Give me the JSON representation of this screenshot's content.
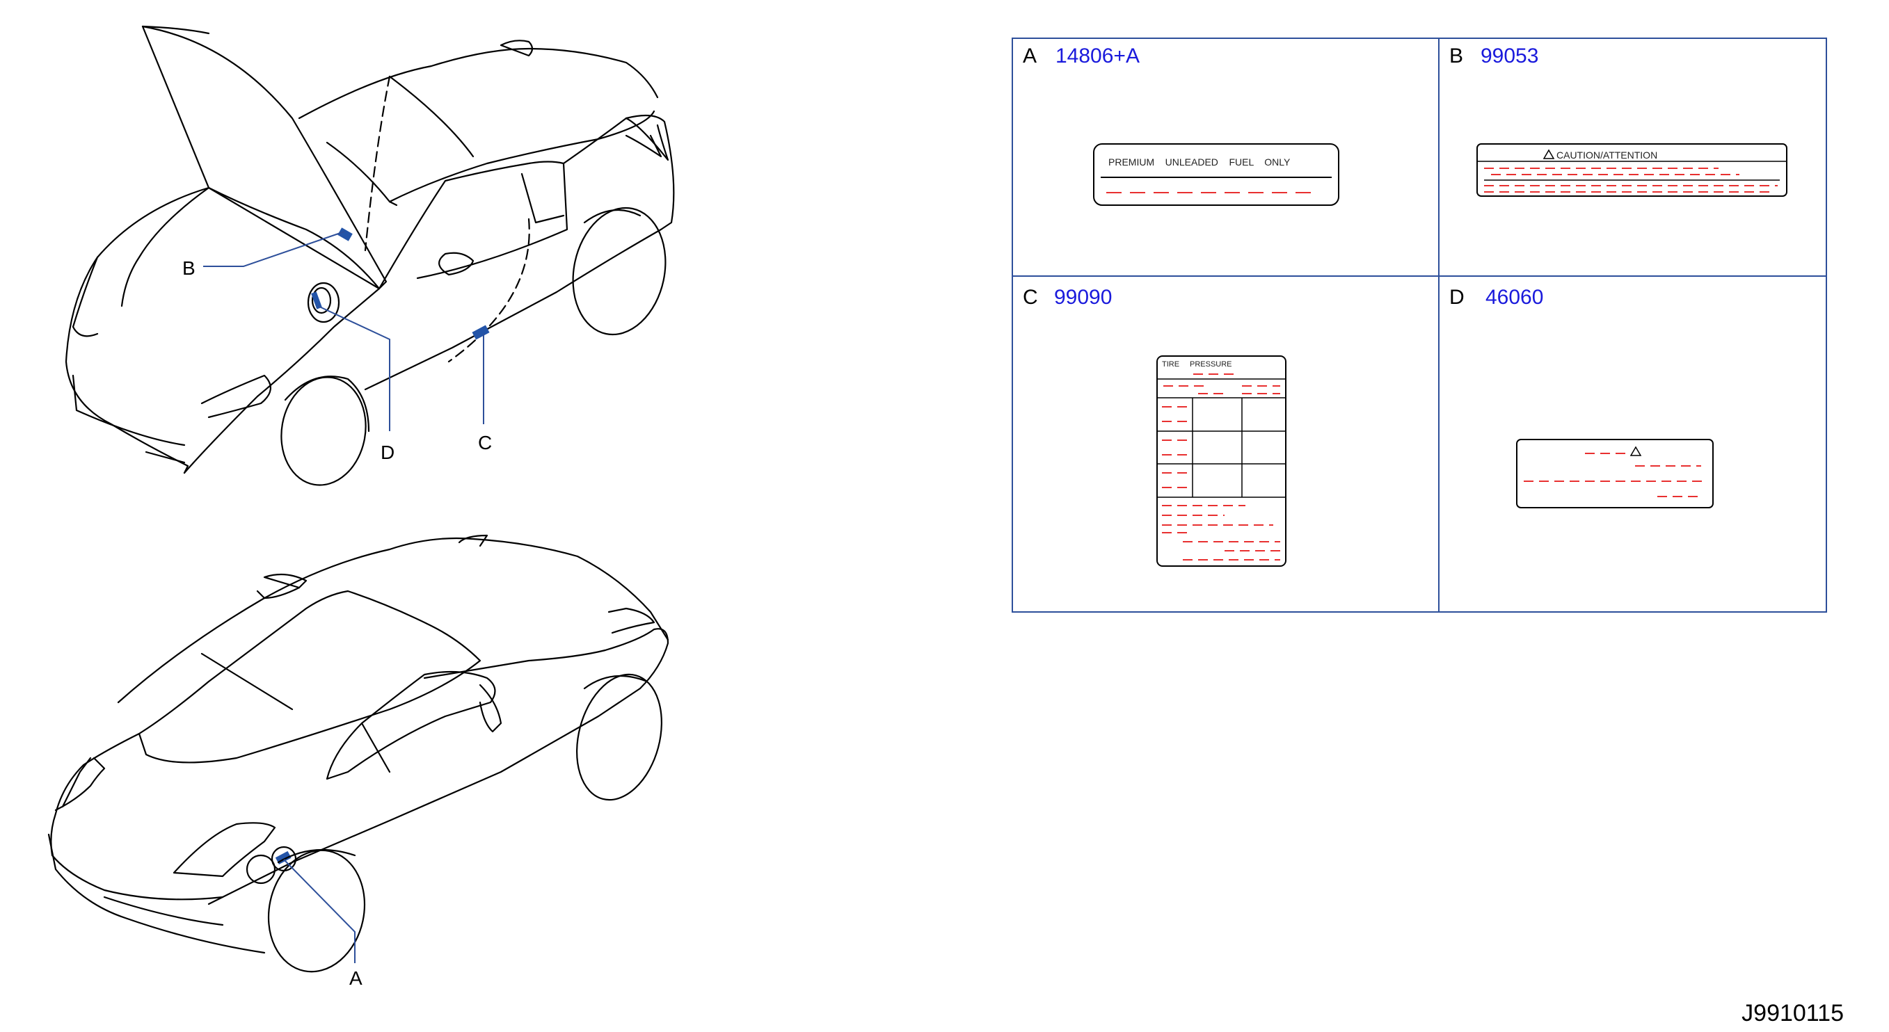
{
  "callouts": {
    "a": "A",
    "b": "B",
    "c": "C",
    "d": "D"
  },
  "labels": [
    {
      "letter": "A",
      "part_no": "14806+A",
      "label_text": "PREMIUM    UNLEADED    FUEL    ONLY"
    },
    {
      "letter": "B",
      "part_no": "99053",
      "label_text": "CAUTION/ATTENTION"
    },
    {
      "letter": "C",
      "part_no": "99090",
      "label_text_1": "TIRE",
      "label_text_2": "PRESSURE"
    },
    {
      "letter": "D",
      "part_no": "46060"
    }
  ],
  "diagram_code": "J9910115",
  "colors": {
    "part_number": "#1a1adc",
    "frame": "#2d4f9a",
    "dashes": "#e83030",
    "label_patch": "#2354a8"
  }
}
